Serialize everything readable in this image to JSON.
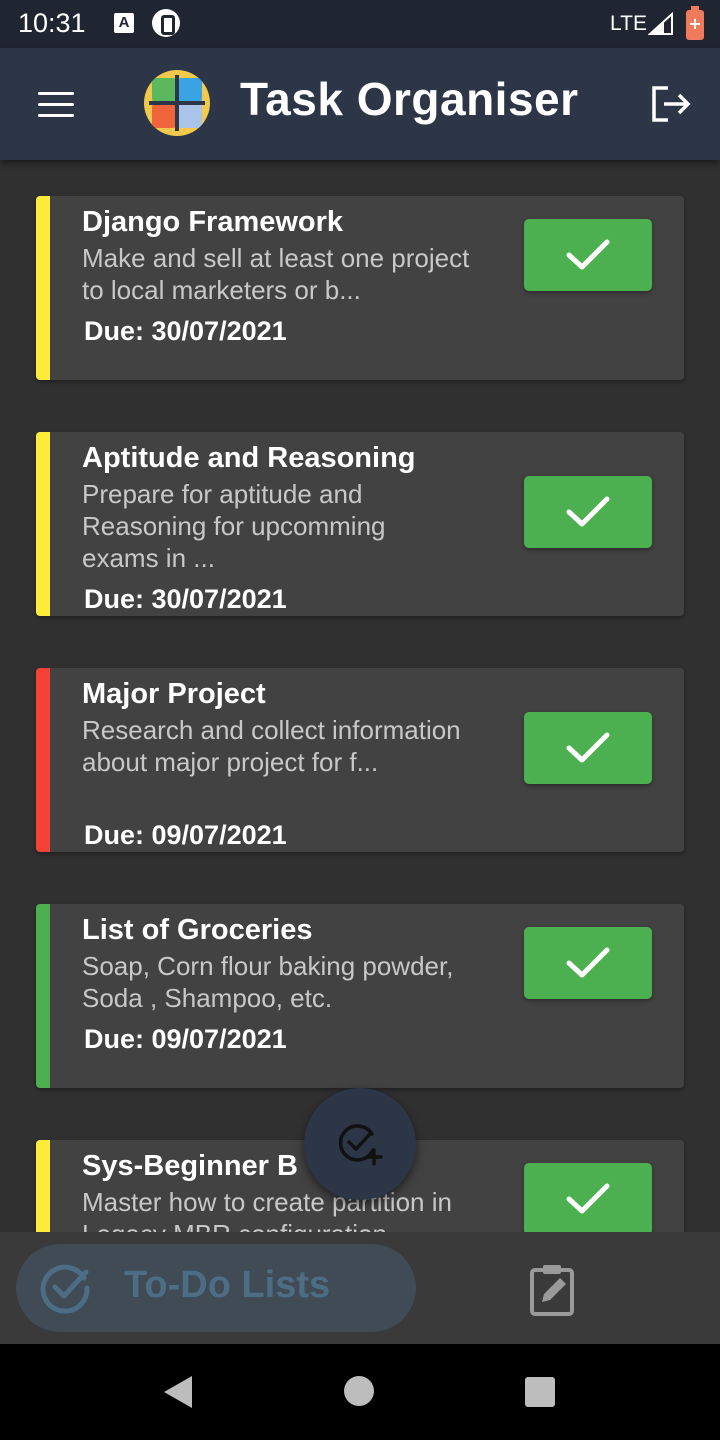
{
  "status_bar": {
    "time": "10:31",
    "network": "LTE"
  },
  "app_bar": {
    "title": "Task Organiser"
  },
  "colors": {
    "appbar": "#2c3647",
    "card": "#424242",
    "done_button": "#4caf50",
    "priority_yellow": "#fdeb3a",
    "priority_red": "#f44336",
    "priority_green": "#4caf50"
  },
  "tasks": [
    {
      "title": "Django Framework",
      "description": "Make and sell at least one project to local marketers or b...",
      "due": "Due: 30/07/2021",
      "priority_color": "#fdeb3a"
    },
    {
      "title": "Aptitude and Reasoning",
      "description": "Prepare for aptitude and Reasoning for upcomming exams in ...",
      "due": "Due: 30/07/2021",
      "priority_color": "#fdeb3a"
    },
    {
      "title": "Major Project",
      "description": "Research and collect information about major project for f...",
      "due": "Due: 09/07/2021",
      "priority_color": "#f44336"
    },
    {
      "title": "List of Groceries",
      "description": "Soap, Corn flour baking powder, Soda , Shampoo, etc.",
      "due": "Due: 09/07/2021",
      "priority_color": "#4caf50"
    },
    {
      "title": "Sys-Beginner B",
      "description": "Master how to create partition in Legacy MBR configuration",
      "due": "",
      "priority_color": "#fdeb3a"
    }
  ],
  "bottom_nav": {
    "active_label": "To-Do Lists",
    "active_icon": "check-circle-icon",
    "second_icon": "clipboard-edit-icon"
  },
  "fab": {
    "icon": "add-task-icon"
  }
}
